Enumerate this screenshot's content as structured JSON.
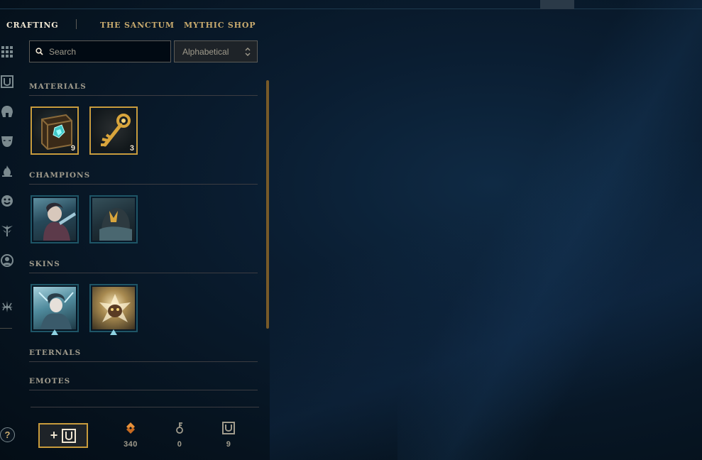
{
  "nav": {
    "tabs": [
      {
        "label": "CRAFTING",
        "active": true
      },
      {
        "label": "THE SANCTUM",
        "active": false
      },
      {
        "label": "MYTHIC SHOP",
        "active": false
      }
    ]
  },
  "rail": {
    "icons": [
      "grid-icon",
      "chest-icon",
      "champion-helmet-icon",
      "skin-mask-icon",
      "ward-flame-icon",
      "emote-face-icon",
      "eternals-icon",
      "profile-icon-icon",
      "loot-misc-icon"
    ]
  },
  "search": {
    "placeholder": "Search",
    "value": ""
  },
  "sort": {
    "selected": "Alphabetical"
  },
  "sections": {
    "materials": {
      "title": "MATERIALS",
      "items": [
        {
          "name": "chest",
          "count": "9"
        },
        {
          "name": "key",
          "count": "3"
        }
      ]
    },
    "champions": {
      "title": "CHAMPIONS"
    },
    "skins": {
      "title": "SKINS"
    },
    "eternals": {
      "title": "ETERNALS"
    },
    "emotes": {
      "title": "EMOTES"
    }
  },
  "help": {
    "label": "?"
  },
  "currencies": {
    "orange_essence": {
      "icon": "orange-essence-icon",
      "value": "340"
    },
    "key_fragments": {
      "icon": "key-fragment-icon",
      "value": "0"
    },
    "chests": {
      "icon": "chest-icon",
      "value": "9"
    }
  },
  "add_chest": {
    "label": "+"
  },
  "colors": {
    "gold": "#c89b3c",
    "gold_text": "#c8aa6e",
    "active_text": "#f0e6d2",
    "muted": "#a09b8c",
    "background": "#0a1d31"
  }
}
